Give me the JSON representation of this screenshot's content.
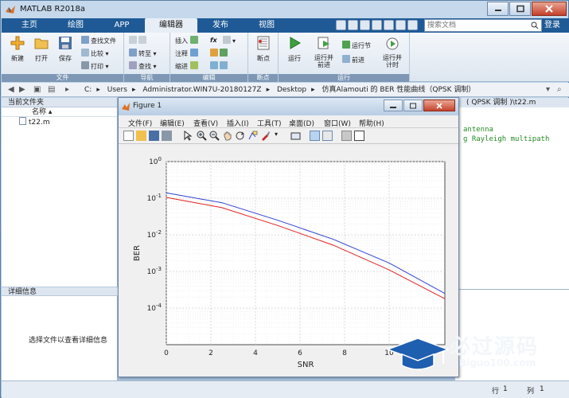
{
  "window": {
    "title": "MATLAB R2018a"
  },
  "tabs": [
    "主页",
    "绘图",
    "APP",
    "编辑器",
    "发布",
    "视图"
  ],
  "search": {
    "placeholder": "搜索文档"
  },
  "signin_label": "登录",
  "ribbon": {
    "file_group": {
      "label": "文件",
      "new": "新建",
      "open": "打开",
      "save": "保存",
      "find_files": "查找文件",
      "compare": "比较",
      "print": "打印"
    },
    "nav_group": {
      "label": "导航",
      "goto": "转至",
      "find": "查找"
    },
    "edit_group": {
      "label": "编辑",
      "insert": "插入",
      "comment": "注释",
      "indent": "缩进",
      "fx": "fx"
    },
    "breakpoint_group": {
      "label": "断点",
      "breakpoints": "断点"
    },
    "run_group": {
      "label": "运行",
      "run": "运行",
      "run_advance": "运行并\n前进",
      "run_section": "运行节",
      "advance": "前进",
      "run_time": "运行并\n计时"
    }
  },
  "path": {
    "segments": [
      "C:",
      "Users",
      "Administrator.WIN7U-20180127Z",
      "Desktop",
      "仿真Alamouti 的 BER 性能曲线（QPSK 调制）"
    ]
  },
  "left_panel": {
    "title": "当前文件夹",
    "column": "名称",
    "files": [
      "t22.m"
    ],
    "detail_title": "详细信息",
    "detail_text": "选择文件以查看详细信息"
  },
  "editor": {
    "tab": "( QPSK 调制 )\\t22.m",
    "code_lines": [
      "antenna",
      "g Rayleigh multipath"
    ]
  },
  "status_bar": {
    "row_label": "行",
    "row": "1",
    "col_label": "列",
    "col": "1"
  },
  "figure": {
    "title": "Figure 1",
    "menu": [
      "文件(F)",
      "编辑(E)",
      "查看(V)",
      "插入(I)",
      "工具(T)",
      "桌面(D)",
      "窗口(W)",
      "帮助(H)"
    ]
  },
  "watermark": {
    "text": "必过源码",
    "sub": "Biguo100.com"
  },
  "chart_data": {
    "type": "line",
    "xlabel": "SNR",
    "ylabel": "BER",
    "xlim": [
      0,
      12.5
    ],
    "ylim": [
      1e-05,
      1
    ],
    "yscale": "log",
    "grid": true,
    "x_ticks": [
      0,
      2,
      4,
      6,
      8,
      10
    ],
    "y_ticks": [
      "10^0",
      "10^-1",
      "10^-2",
      "10^-3",
      "10^-4"
    ],
    "series": [
      {
        "color": "#2b3fd6",
        "x": [
          0,
          2.5,
          5,
          7.5,
          10,
          12.5
        ],
        "y": [
          0.14,
          0.075,
          0.025,
          0.0075,
          0.0017,
          0.00025
        ]
      },
      {
        "color": "#e02020",
        "x": [
          0,
          2.5,
          5,
          7.5,
          10,
          12.5
        ],
        "y": [
          0.105,
          0.055,
          0.018,
          0.0052,
          0.0011,
          0.00018
        ]
      }
    ]
  }
}
